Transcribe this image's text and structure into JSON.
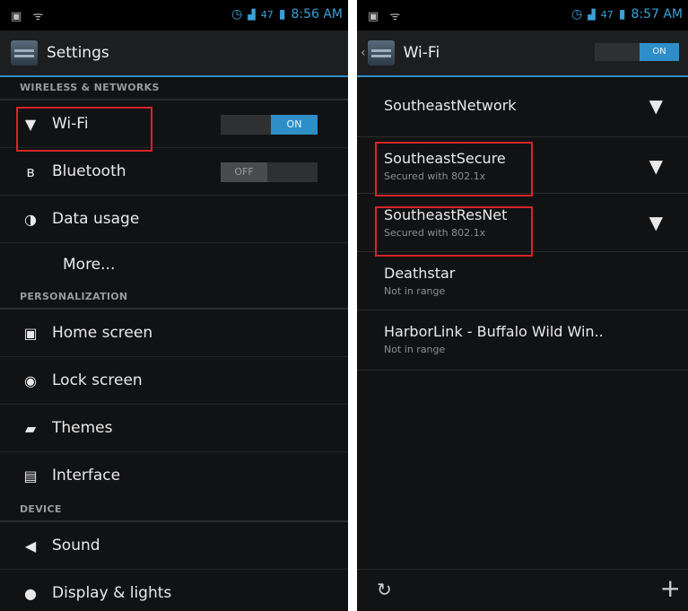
{
  "left": {
    "status_time": "8:56 AM",
    "status_signal": "47",
    "title": "Settings",
    "sections": {
      "wireless": "WIRELESS & NETWORKS",
      "personalization": "PERSONALIZATION",
      "device": "DEVICE"
    },
    "items": {
      "wifi": {
        "label": "Wi-Fi",
        "toggle": "ON"
      },
      "bluetooth": {
        "label": "Bluetooth",
        "toggle": "OFF"
      },
      "data_usage": {
        "label": "Data usage"
      },
      "more": {
        "label": "More..."
      },
      "home_screen": {
        "label": "Home screen"
      },
      "lock_screen": {
        "label": "Lock screen"
      },
      "themes": {
        "label": "Themes"
      },
      "interface": {
        "label": "Interface"
      },
      "sound": {
        "label": "Sound"
      },
      "display": {
        "label": "Display & lights"
      }
    }
  },
  "right": {
    "status_time": "8:57 AM",
    "status_signal": "47",
    "title": "Wi-Fi",
    "toggle": "ON",
    "networks": [
      {
        "name": "SoutheastNetwork",
        "sub": ""
      },
      {
        "name": "SoutheastSecure",
        "sub": "Secured with 802.1x"
      },
      {
        "name": "SoutheastResNet",
        "sub": "Secured with 802.1x"
      },
      {
        "name": "Deathstar",
        "sub": "Not in range"
      },
      {
        "name": "HarborLink - Buffalo Wild Win..",
        "sub": "Not in range"
      }
    ]
  },
  "colors": {
    "accent": "#2e8ec8",
    "highlight": "#d8242a"
  }
}
